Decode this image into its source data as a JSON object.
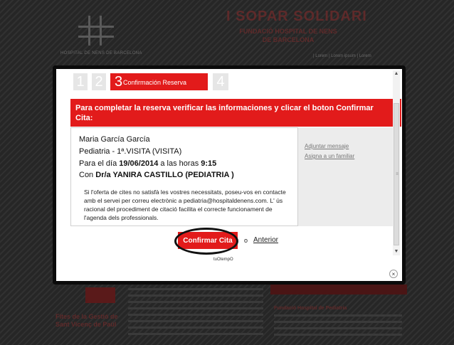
{
  "background": {
    "title": "I SOPAR SOLIDARI",
    "subtitle": "FUNDACIÓ HOSPITAL DE NENS DE BARCELONA",
    "logo_text": "HOSPITAL DE NENS DE BARCELONA",
    "links": "| Lorem | Lorem ipsum |  Lorem",
    "sidebar_title": "Fites de la Gestió de Sant Vicenç de Paül",
    "right_title": "Fundació Hospital de Pediatria"
  },
  "steps": [
    {
      "number": "1"
    },
    {
      "number": "2"
    },
    {
      "number": "3",
      "label": "Confirmación Reserva",
      "active": true
    },
    {
      "number": "4"
    }
  ],
  "banner": {
    "text": "Para completar la reserva verificar las informaciones y clicar el boton Confirmar Cita:"
  },
  "appointment": {
    "patient": "Maria García García",
    "specialty": "Pediatria - 1ª.VISITA (VISITA)",
    "date_prefix": "Para el día ",
    "date": "19/06/2014",
    "time_prefix": " a las horas ",
    "time": "9:15",
    "doctor_prefix": "Con ",
    "doctor": "Dr/a YANIRA CASTILLO (PEDIATRIA )",
    "note": "Si l'oferta de cites no satisfà les vostres necessitats, poseu-vos en contacte amb el servei per correu electrònic a pediatria@hospitaldenens.com. L' ús racional del procediment de citació facilita el correcte funcionament de l'agenda dels professionals."
  },
  "side_panel": {
    "attach_message": "Adjuntar mensaje",
    "assign_family": "Asigna a un familiar"
  },
  "actions": {
    "confirm": "Confirmar Cita",
    "or": "o",
    "previous": "Anterior"
  },
  "credit": "tuOtempO",
  "close_label": "×",
  "scrollbar": {
    "up": "▲",
    "down": "▼",
    "grip": "≡"
  },
  "colors": {
    "accent": "#e21b1b",
    "step_inactive": "#e6e6e6",
    "side_panel": "#ececec"
  }
}
